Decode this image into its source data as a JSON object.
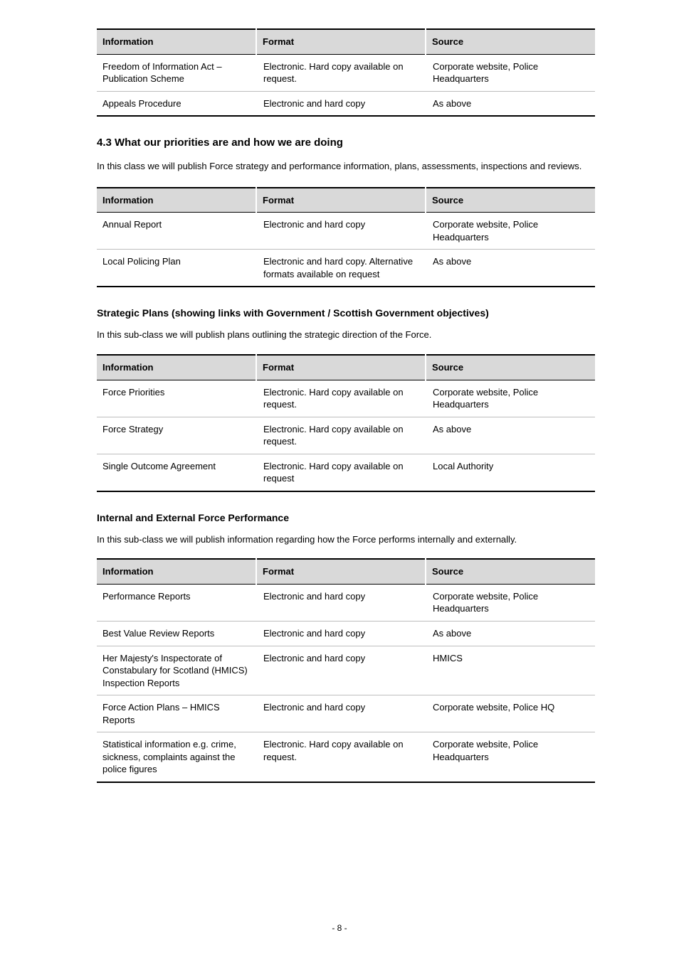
{
  "table1": {
    "headers": [
      "Information",
      "Format",
      "Source"
    ],
    "rows": [
      [
        "Freedom of Information Act – Publication Scheme",
        "Electronic.  Hard copy available on request.",
        "Corporate website, Police Headquarters"
      ],
      [
        "Appeals Procedure",
        "Electronic and hard copy",
        "As above"
      ]
    ]
  },
  "section": {
    "heading": "4.3 What our priorities are and how we are doing",
    "intro": "In this class we will publish Force strategy and performance information, plans, assessments, inspections and reviews."
  },
  "table2": {
    "headers": [
      "Information",
      "Format",
      "Source"
    ],
    "rows": [
      [
        "Annual Report",
        "Electronic and hard copy",
        "Corporate website, Police Headquarters"
      ],
      [
        "Local Policing Plan",
        "Electronic and hard copy.  Alternative formats available on request",
        "As above"
      ]
    ]
  },
  "sub1": {
    "heading": "Strategic Plans (showing links with Government / Scottish Government objectives)",
    "intro": "In this sub-class we will publish plans outlining the strategic direction of the Force."
  },
  "table3": {
    "headers": [
      "Information",
      "Format",
      "Source"
    ],
    "rows": [
      [
        "Force Priorities",
        "Electronic.  Hard copy available on request.",
        "Corporate website, Police Headquarters"
      ],
      [
        "Force Strategy",
        "Electronic.  Hard copy available on request.",
        "As above"
      ],
      [
        "Single Outcome Agreement",
        "Electronic.  Hard copy available on request",
        "Local Authority"
      ]
    ]
  },
  "sub2": {
    "heading": "Internal and External Force Performance",
    "intro": "In this sub-class we will publish information regarding how the Force performs internally and externally."
  },
  "table4": {
    "headers": [
      "Information",
      "Format",
      "Source"
    ],
    "rows": [
      [
        "Performance Reports",
        "Electronic and hard copy",
        "Corporate website, Police Headquarters"
      ],
      [
        "Best Value Review Reports",
        "Electronic and hard copy",
        "As above"
      ],
      [
        "Her Majesty's Inspectorate of Constabulary for Scotland (HMICS) Inspection Reports",
        "Electronic and hard copy",
        "HMICS"
      ],
      [
        "Force Action Plans – HMICS Reports",
        "Electronic and hard copy",
        "Corporate website, Police HQ"
      ],
      [
        "Statistical information e.g. crime, sickness, complaints against the police figures",
        "Electronic.  Hard copy available on request.",
        "Corporate website, Police Headquarters"
      ]
    ]
  },
  "footer": "- 8 -"
}
